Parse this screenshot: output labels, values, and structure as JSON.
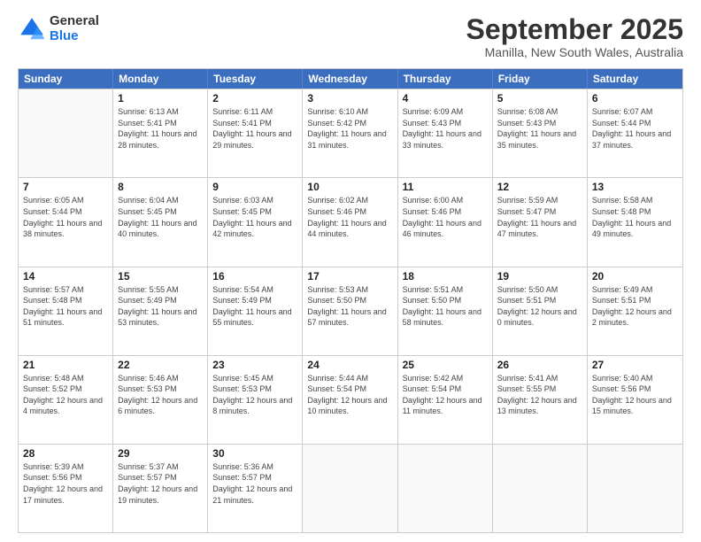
{
  "logo": {
    "general": "General",
    "blue": "Blue"
  },
  "title": "September 2025",
  "subtitle": "Manilla, New South Wales, Australia",
  "days": [
    "Sunday",
    "Monday",
    "Tuesday",
    "Wednesday",
    "Thursday",
    "Friday",
    "Saturday"
  ],
  "rows": [
    [
      {
        "day": "",
        "empty": true
      },
      {
        "day": "1",
        "sunrise": "6:13 AM",
        "sunset": "5:41 PM",
        "daylight": "11 hours and 28 minutes."
      },
      {
        "day": "2",
        "sunrise": "6:11 AM",
        "sunset": "5:41 PM",
        "daylight": "11 hours and 29 minutes."
      },
      {
        "day": "3",
        "sunrise": "6:10 AM",
        "sunset": "5:42 PM",
        "daylight": "11 hours and 31 minutes."
      },
      {
        "day": "4",
        "sunrise": "6:09 AM",
        "sunset": "5:43 PM",
        "daylight": "11 hours and 33 minutes."
      },
      {
        "day": "5",
        "sunrise": "6:08 AM",
        "sunset": "5:43 PM",
        "daylight": "11 hours and 35 minutes."
      },
      {
        "day": "6",
        "sunrise": "6:07 AM",
        "sunset": "5:44 PM",
        "daylight": "11 hours and 37 minutes."
      }
    ],
    [
      {
        "day": "7",
        "sunrise": "6:05 AM",
        "sunset": "5:44 PM",
        "daylight": "11 hours and 38 minutes."
      },
      {
        "day": "8",
        "sunrise": "6:04 AM",
        "sunset": "5:45 PM",
        "daylight": "11 hours and 40 minutes."
      },
      {
        "day": "9",
        "sunrise": "6:03 AM",
        "sunset": "5:45 PM",
        "daylight": "11 hours and 42 minutes."
      },
      {
        "day": "10",
        "sunrise": "6:02 AM",
        "sunset": "5:46 PM",
        "daylight": "11 hours and 44 minutes."
      },
      {
        "day": "11",
        "sunrise": "6:00 AM",
        "sunset": "5:46 PM",
        "daylight": "11 hours and 46 minutes."
      },
      {
        "day": "12",
        "sunrise": "5:59 AM",
        "sunset": "5:47 PM",
        "daylight": "11 hours and 47 minutes."
      },
      {
        "day": "13",
        "sunrise": "5:58 AM",
        "sunset": "5:48 PM",
        "daylight": "11 hours and 49 minutes."
      }
    ],
    [
      {
        "day": "14",
        "sunrise": "5:57 AM",
        "sunset": "5:48 PM",
        "daylight": "11 hours and 51 minutes."
      },
      {
        "day": "15",
        "sunrise": "5:55 AM",
        "sunset": "5:49 PM",
        "daylight": "11 hours and 53 minutes."
      },
      {
        "day": "16",
        "sunrise": "5:54 AM",
        "sunset": "5:49 PM",
        "daylight": "11 hours and 55 minutes."
      },
      {
        "day": "17",
        "sunrise": "5:53 AM",
        "sunset": "5:50 PM",
        "daylight": "11 hours and 57 minutes."
      },
      {
        "day": "18",
        "sunrise": "5:51 AM",
        "sunset": "5:50 PM",
        "daylight": "11 hours and 58 minutes."
      },
      {
        "day": "19",
        "sunrise": "5:50 AM",
        "sunset": "5:51 PM",
        "daylight": "12 hours and 0 minutes."
      },
      {
        "day": "20",
        "sunrise": "5:49 AM",
        "sunset": "5:51 PM",
        "daylight": "12 hours and 2 minutes."
      }
    ],
    [
      {
        "day": "21",
        "sunrise": "5:48 AM",
        "sunset": "5:52 PM",
        "daylight": "12 hours and 4 minutes."
      },
      {
        "day": "22",
        "sunrise": "5:46 AM",
        "sunset": "5:53 PM",
        "daylight": "12 hours and 6 minutes."
      },
      {
        "day": "23",
        "sunrise": "5:45 AM",
        "sunset": "5:53 PM",
        "daylight": "12 hours and 8 minutes."
      },
      {
        "day": "24",
        "sunrise": "5:44 AM",
        "sunset": "5:54 PM",
        "daylight": "12 hours and 10 minutes."
      },
      {
        "day": "25",
        "sunrise": "5:42 AM",
        "sunset": "5:54 PM",
        "daylight": "12 hours and 11 minutes."
      },
      {
        "day": "26",
        "sunrise": "5:41 AM",
        "sunset": "5:55 PM",
        "daylight": "12 hours and 13 minutes."
      },
      {
        "day": "27",
        "sunrise": "5:40 AM",
        "sunset": "5:56 PM",
        "daylight": "12 hours and 15 minutes."
      }
    ],
    [
      {
        "day": "28",
        "sunrise": "5:39 AM",
        "sunset": "5:56 PM",
        "daylight": "12 hours and 17 minutes."
      },
      {
        "day": "29",
        "sunrise": "5:37 AM",
        "sunset": "5:57 PM",
        "daylight": "12 hours and 19 minutes."
      },
      {
        "day": "30",
        "sunrise": "5:36 AM",
        "sunset": "5:57 PM",
        "daylight": "12 hours and 21 minutes."
      },
      {
        "day": "",
        "empty": true
      },
      {
        "day": "",
        "empty": true
      },
      {
        "day": "",
        "empty": true
      },
      {
        "day": "",
        "empty": true
      }
    ]
  ]
}
